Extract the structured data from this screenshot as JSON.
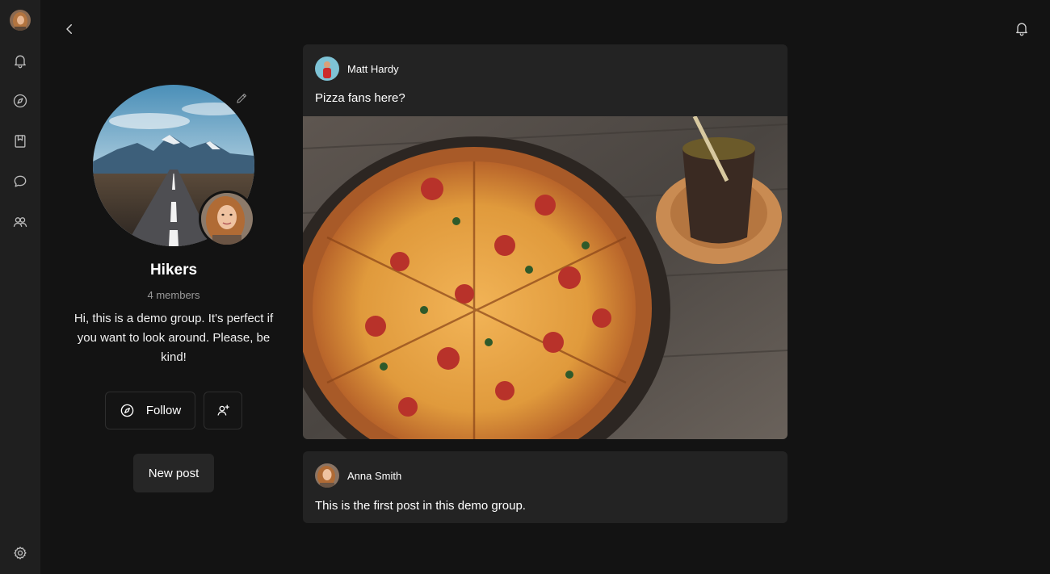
{
  "group": {
    "name": "Hikers",
    "members": "4 members",
    "description": "Hi, this is a demo group. It's perfect if you want to look around. Please, be kind!"
  },
  "actions": {
    "follow_label": "Follow",
    "new_post_label": "New post"
  },
  "posts": [
    {
      "author": "Matt Hardy",
      "text": "Pizza fans here?"
    },
    {
      "author": "Anna Smith",
      "text": "This is the first post in this demo group."
    }
  ],
  "icons": {
    "sidebar": [
      "bell-icon",
      "compass-icon",
      "bookmark-icon",
      "chat-icon",
      "people-icon",
      "gear-icon"
    ],
    "top": [
      "back-arrow-icon",
      "bell-icon"
    ]
  },
  "colors": {
    "background": "#131313",
    "sidebar": "#1f1f1f",
    "card": "#232323",
    "button": "#262626"
  }
}
